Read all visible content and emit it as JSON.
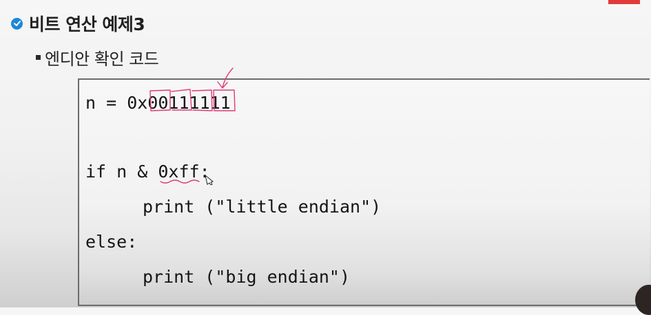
{
  "slide": {
    "title": "비트 연산 예제3",
    "subtitle": "엔디안 확인 코드"
  },
  "code": {
    "line1": "n = 0x00111111",
    "line2": "if n & 0xff:",
    "line3": "print (\"little endian\")",
    "line4": "else:",
    "line5": "print (\"big endian\")"
  },
  "icons": {
    "title_bullet": "check-circle-icon",
    "subtitle_bullet": "square-bullet-icon",
    "cursor": "pen-cursor-icon"
  },
  "colors": {
    "accent_red": "#e23a3a",
    "check_blue": "#1e88d8",
    "annotation_pink": "#e03a78",
    "code_border": "#6b6b6b"
  }
}
